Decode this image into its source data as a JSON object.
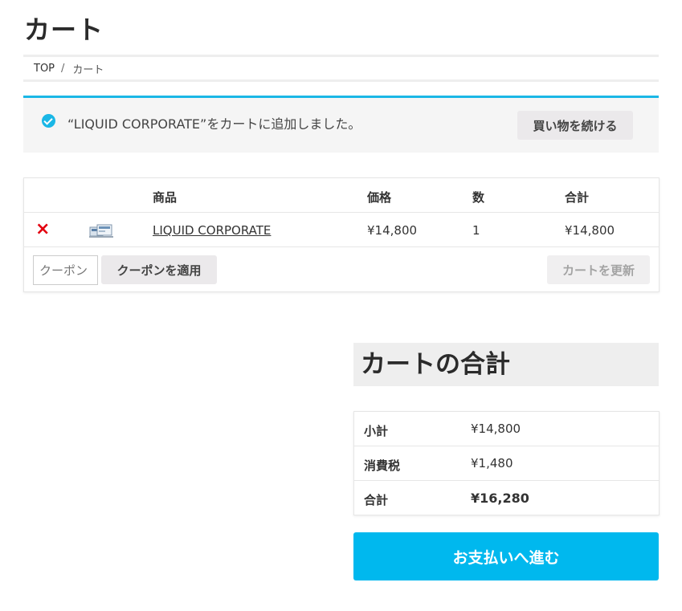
{
  "page": {
    "title": "カート"
  },
  "breadcrumb": {
    "home": "TOP",
    "separator": "/",
    "current": "カート"
  },
  "notice": {
    "message": "“LIQUID CORPORATE”をカートに追加しました。",
    "continue_label": "買い物を続ける",
    "accent": "#1ab7e6"
  },
  "cart": {
    "headers": {
      "product": "商品",
      "price": "価格",
      "quantity": "数",
      "total": "合計"
    },
    "items": [
      {
        "remove": "×",
        "name": "LIQUID CORPORATE",
        "price": "¥14,800",
        "quantity": "1",
        "total": "¥14,800"
      }
    ],
    "coupon_placeholder": "クーポン",
    "apply_label": "クーポンを適用",
    "update_label": "カートを更新"
  },
  "totals": {
    "title": "カートの合計",
    "subtotal_label": "小計",
    "subtotal": "¥14,800",
    "tax_label": "消費税",
    "tax": "¥1,480",
    "total_label": "合計",
    "total": "¥16,280"
  },
  "checkout": {
    "label": "お支払いへ進む",
    "color": "#00b8ee"
  }
}
